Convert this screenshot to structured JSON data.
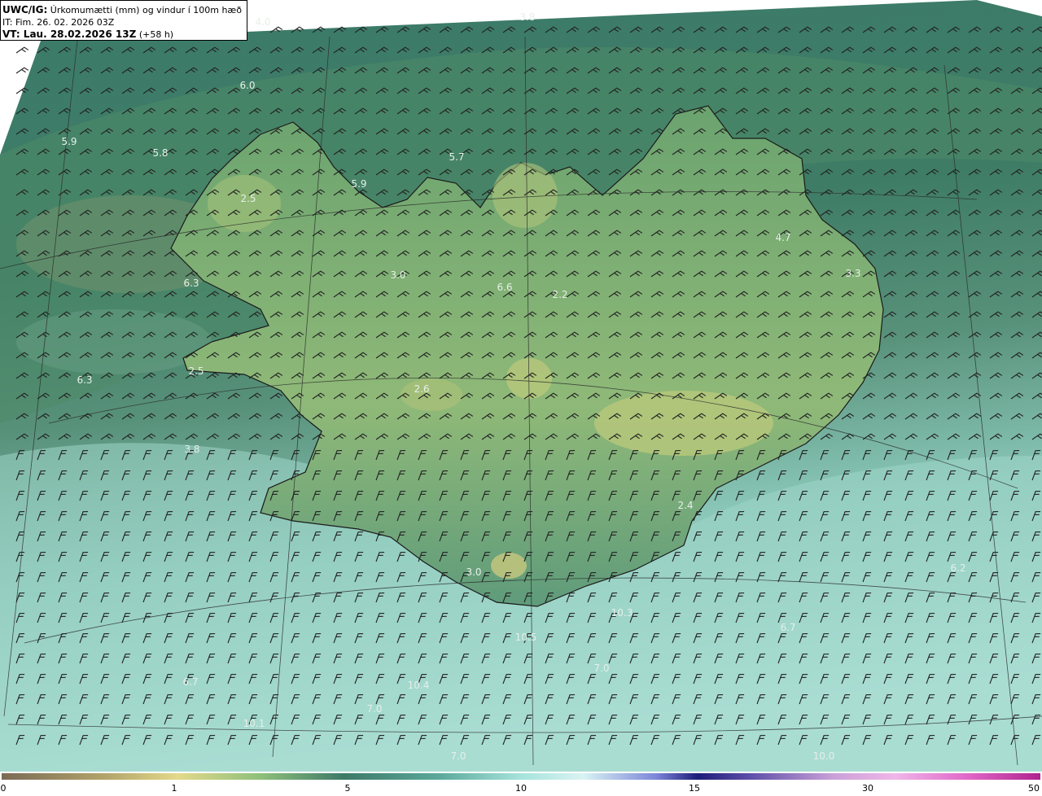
{
  "header": {
    "product": "UWC/IG:",
    "description": "Úrkomumætti (mm) og vindur í 100m hæð",
    "issue_time": "IT: Fim. 26. 02. 2026 03Z",
    "valid_label": "VT: Lau. 28.02.2026 13Z",
    "valid_offset": "(+58 h)"
  },
  "colors": {
    "outside": "#ffffff",
    "low": "#8c8660",
    "mid": "#3f7a66",
    "high": "#c7f0ea",
    "coast": "#1a1a1a",
    "barb": "#222222"
  },
  "values": [
    {
      "label": "4.0"
    },
    {
      "label": "3.8"
    },
    {
      "label": "6.0"
    },
    {
      "label": "5.9"
    },
    {
      "label": "5.8"
    },
    {
      "label": "5.7"
    },
    {
      "label": "2.5"
    },
    {
      "label": "5.9"
    },
    {
      "label": "4.7"
    },
    {
      "label": "6.3"
    },
    {
      "label": "3.0"
    },
    {
      "label": "6.6"
    },
    {
      "label": "2.2"
    },
    {
      "label": "3.3"
    },
    {
      "label": "6.3"
    },
    {
      "label": "2.5"
    },
    {
      "label": "2.6"
    },
    {
      "label": "3.8"
    },
    {
      "label": "2.4"
    },
    {
      "label": "3.0"
    },
    {
      "label": "6.2"
    },
    {
      "label": "10.3"
    },
    {
      "label": "6.7"
    },
    {
      "label": "10.5"
    },
    {
      "label": "7.0"
    },
    {
      "label": "10.4"
    },
    {
      "label": "7.0"
    },
    {
      "label": "10.1"
    },
    {
      "label": "7.0"
    },
    {
      "label": "10.0"
    },
    {
      "label": "6.7"
    }
  ],
  "colorbar": {
    "ticks": [
      "0",
      "1",
      "5",
      "10",
      "15",
      "30",
      "50"
    ]
  }
}
